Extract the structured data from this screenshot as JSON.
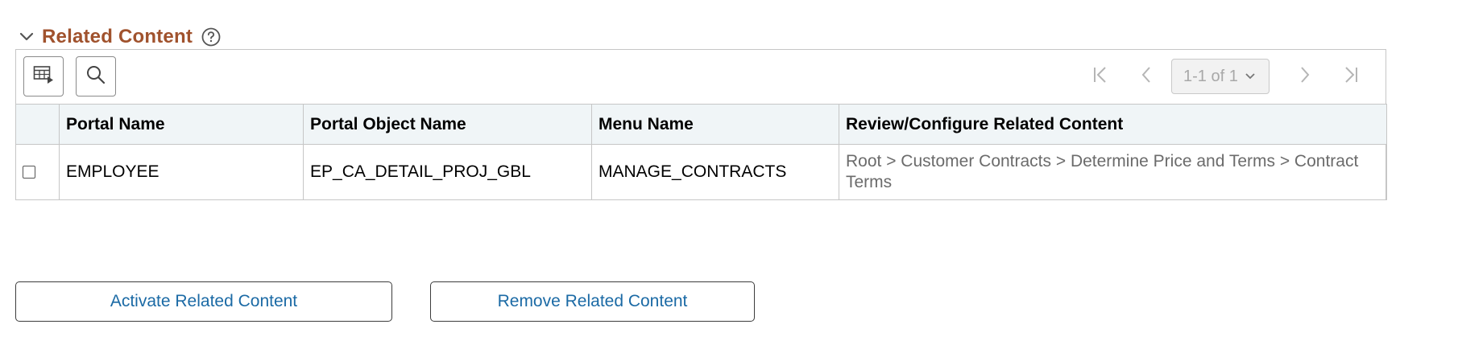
{
  "section": {
    "title": "Related Content",
    "collapse_icon": "chevron-down-icon",
    "help_icon": "help-icon"
  },
  "toolbar": {
    "personalize_icon": "grid-personalize-icon",
    "search_icon": "search-icon"
  },
  "pager": {
    "first_icon": "first-page-icon",
    "prev_icon": "previous-page-icon",
    "range": "1-1 of 1",
    "next_icon": "next-page-icon",
    "last_icon": "last-page-icon"
  },
  "table": {
    "headers": {
      "portal_name": "Portal Name",
      "portal_object_name": "Portal Object Name",
      "menu_name": "Menu Name",
      "review_configure": "Review/Configure Related Content"
    },
    "rows": [
      {
        "selected": false,
        "portal_name": "EMPLOYEE",
        "portal_object_name": "EP_CA_DETAIL_PROJ_GBL",
        "menu_name": "MANAGE_CONTRACTS",
        "path": "Root > Customer Contracts > Determine Price and Terms > Contract Terms"
      }
    ]
  },
  "actions": {
    "activate_label": "Activate Related Content",
    "remove_label": "Remove Related Content"
  },
  "colors": {
    "section_title": "#a0522d",
    "link_blue": "#1b6aa5",
    "header_bg": "#f0f5f7",
    "path_text": "#6b6b6b"
  }
}
